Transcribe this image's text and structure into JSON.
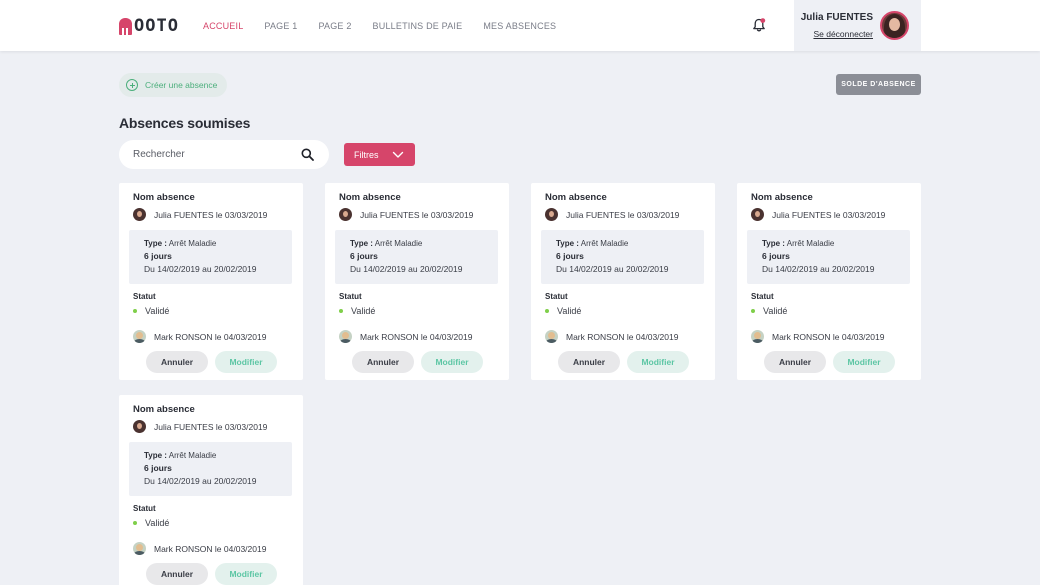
{
  "brand": {
    "logo_text": "OOTO"
  },
  "nav": {
    "items": [
      {
        "label": "ACCUEIL",
        "active": true
      },
      {
        "label": "PAGE 1",
        "active": false
      },
      {
        "label": "PAGE 2",
        "active": false
      },
      {
        "label": "BULLETINS DE PAIE",
        "active": false
      },
      {
        "label": "MES ABSENCES",
        "active": false
      }
    ]
  },
  "user": {
    "name": "Julia FUENTES",
    "logout_label": "Se déconnecter"
  },
  "toolbar": {
    "create_label": "Créer une absence",
    "solde_label": "SOLDE D'ABSENCE",
    "section_title": "Absences soumises",
    "search_placeholder": "Rechercher",
    "filter_label": "Filtres"
  },
  "colors": {
    "accent": "#d6456a",
    "success": "#4caf7c",
    "status_valid": "#7fcf4a"
  },
  "cards": [
    {
      "title": "Nom absence",
      "author": "Julia FUENTES le 03/03/2019",
      "type_label": "Type :",
      "type_value": " Arrêt Maladie",
      "days": "6 jours",
      "range": "Du 14/02/2019 au 20/02/2019",
      "status_label": "Statut",
      "status_value": "Validé",
      "validator": "Mark RONSON le 04/03/2019",
      "cancel_label": "Annuler",
      "edit_label": "Modifier"
    },
    {
      "title": "Nom absence",
      "author": "Julia FUENTES le 03/03/2019",
      "type_label": "Type :",
      "type_value": " Arrêt Maladie",
      "days": "6 jours",
      "range": "Du 14/02/2019 au 20/02/2019",
      "status_label": "Statut",
      "status_value": "Validé",
      "validator": "Mark RONSON le 04/03/2019",
      "cancel_label": "Annuler",
      "edit_label": "Modifier"
    },
    {
      "title": "Nom absence",
      "author": "Julia FUENTES le 03/03/2019",
      "type_label": "Type :",
      "type_value": " Arrêt Maladie",
      "days": "6 jours",
      "range": "Du 14/02/2019 au 20/02/2019",
      "status_label": "Statut",
      "status_value": "Validé",
      "validator": "Mark RONSON le 04/03/2019",
      "cancel_label": "Annuler",
      "edit_label": "Modifier"
    },
    {
      "title": "Nom absence",
      "author": "Julia FUENTES le 03/03/2019",
      "type_label": "Type :",
      "type_value": " Arrêt Maladie",
      "days": "6 jours",
      "range": "Du 14/02/2019 au 20/02/2019",
      "status_label": "Statut",
      "status_value": "Validé",
      "validator": "Mark RONSON le 04/03/2019",
      "cancel_label": "Annuler",
      "edit_label": "Modifier"
    },
    {
      "title": "Nom absence",
      "author": "Julia FUENTES le 03/03/2019",
      "type_label": "Type :",
      "type_value": " Arrêt Maladie",
      "days": "6 jours",
      "range": "Du 14/02/2019 au 20/02/2019",
      "status_label": "Statut",
      "status_value": "Validé",
      "validator": "Mark RONSON le 04/03/2019",
      "cancel_label": "Annuler",
      "edit_label": "Modifier"
    }
  ]
}
